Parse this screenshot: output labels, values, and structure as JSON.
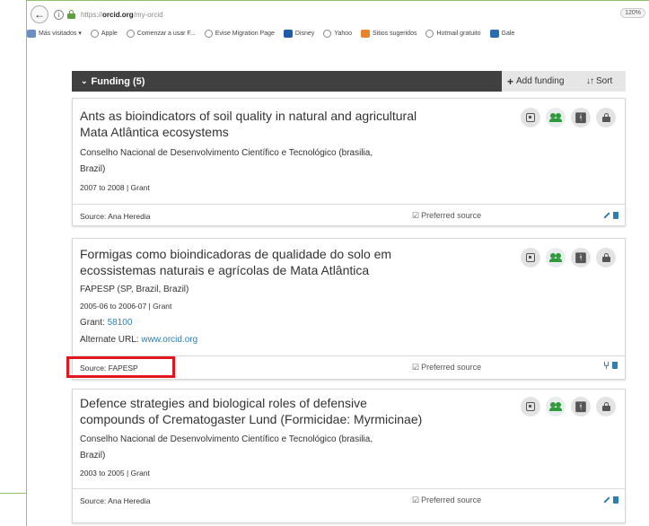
{
  "browser": {
    "back_glyph": "←",
    "url_prefix": "https://",
    "url_domain": "orcid.org",
    "url_path": "/my-orcid",
    "zoom": "120%",
    "bookmarks": [
      {
        "label": "Más visitados ▾",
        "icon": "folder-icon"
      },
      {
        "label": "Apple",
        "icon": "globe-icon"
      },
      {
        "label": "Comenzar a usar F...",
        "icon": "globe-icon"
      },
      {
        "label": "Evise Migration Page",
        "icon": "globe-icon"
      },
      {
        "label": "Disney",
        "icon": "disney-icon"
      },
      {
        "label": "Yahoo",
        "icon": "globe-icon"
      },
      {
        "label": "Sitios sugeridos",
        "icon": "sites-icon"
      },
      {
        "label": "Hotmail gratuito",
        "icon": "globe-icon"
      },
      {
        "label": "Gale",
        "icon": "gallery-icon"
      }
    ]
  },
  "funding": {
    "title": "Funding (5)",
    "add_label": "Add funding",
    "sort_label": "Sort"
  },
  "cards": [
    {
      "title_line1": "Ants as bioindicators of soil quality in natural and agricultural",
      "title_line2": "Mata Atlântica ecosystems",
      "org_line1": "Conselho Nacional de Desenvolvimento Científico e Tecnológico (brasilia,",
      "org_line2": "Brazil)",
      "date": "2007 to 2008 | Grant",
      "source": "Source: Ana Heredia",
      "preferred": "Preferred source"
    },
    {
      "title_line1": "Formigas como bioindicadoras de qualidade do solo em",
      "title_line2": "ecossistemas naturais e agrícolas de Mata Atlântica",
      "org_line1": "FAPESP (SP, Brazil, Brazil)",
      "date": "2005-06 to 2006-07 | Grant",
      "grant_label": "Grant: ",
      "grant_value": "58100",
      "alt_label": "Alternate URL: ",
      "alt_value": "www.orcid.org",
      "source": "Source: FAPESP",
      "preferred": "Preferred source"
    },
    {
      "title_line1": "Defence strategies and biological roles of defensive",
      "title_line2": "compounds of Crematogaster Lund (Formicidae: Myrmicinae)",
      "org_line1": "Conselho Nacional de Desenvolvimento Científico e Tecnológico (brasilia,",
      "org_line2": "Brazil)",
      "date": "2003 to 2005 | Grant",
      "source": "Source: Ana Heredia",
      "preferred": "Preferred source"
    }
  ],
  "colors": {
    "header_dark": "#404040",
    "link_blue": "#2e7eaf",
    "highlight_red": "#e0181e",
    "visibility_green": "#2f9a3a"
  }
}
